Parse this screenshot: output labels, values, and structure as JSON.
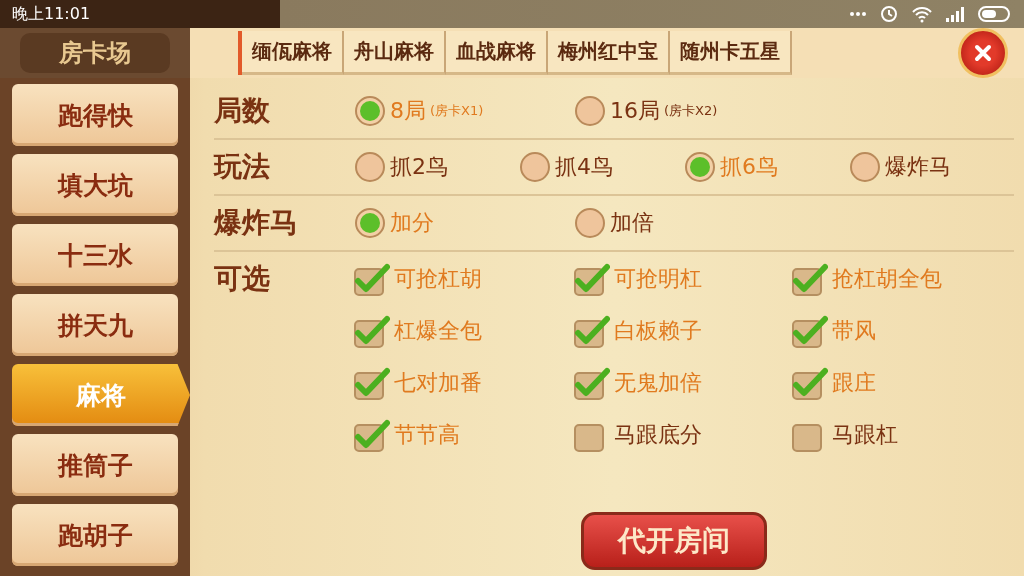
{
  "status_bar": {
    "time": "晚上11:01"
  },
  "header": {
    "title": "房卡场"
  },
  "tabs": [
    {
      "label": "缅佤麻将",
      "selected": false
    },
    {
      "label": "舟山麻将",
      "selected": false
    },
    {
      "label": "血战麻将",
      "selected": false
    },
    {
      "label": "梅州红中宝",
      "selected": false
    },
    {
      "label": "随州卡五星",
      "selected": false
    }
  ],
  "sidebar": {
    "items": [
      {
        "label": "跑得快",
        "selected": false
      },
      {
        "label": "填大坑",
        "selected": false
      },
      {
        "label": "十三水",
        "selected": false
      },
      {
        "label": "拼天九",
        "selected": false
      },
      {
        "label": "麻将",
        "selected": true
      },
      {
        "label": "推筒子",
        "selected": false
      },
      {
        "label": "跑胡子",
        "selected": false
      }
    ]
  },
  "rule_groups": [
    {
      "label": "局数",
      "kind": "radio",
      "options": [
        {
          "label": "8局",
          "note": "(房卡X1)",
          "selected": true
        },
        {
          "label": "16局",
          "note": "(房卡X2)",
          "selected": false
        }
      ]
    },
    {
      "label": "玩法",
      "kind": "radio",
      "options": [
        {
          "label": "抓2鸟",
          "selected": false
        },
        {
          "label": "抓4鸟",
          "selected": false
        },
        {
          "label": "抓6鸟",
          "selected": true
        },
        {
          "label": "爆炸马",
          "selected": false
        }
      ]
    },
    {
      "label": "爆炸马",
      "kind": "radio",
      "options": [
        {
          "label": "加分",
          "selected": true
        },
        {
          "label": "加倍",
          "selected": false
        }
      ]
    },
    {
      "label": "可选",
      "kind": "checkbox",
      "options": [
        {
          "label": "可抢杠胡",
          "checked": true
        },
        {
          "label": "可抢明杠",
          "checked": true
        },
        {
          "label": "抢杠胡全包",
          "checked": true
        },
        {
          "label": "杠爆全包",
          "checked": true
        },
        {
          "label": "白板赖子",
          "checked": true
        },
        {
          "label": "带风",
          "checked": true
        },
        {
          "label": "七对加番",
          "checked": true
        },
        {
          "label": "无鬼加倍",
          "checked": true
        },
        {
          "label": "跟庄",
          "checked": true
        },
        {
          "label": "节节高",
          "checked": true
        },
        {
          "label": "马跟底分",
          "checked": false
        },
        {
          "label": "马跟杠",
          "checked": false
        }
      ]
    }
  ],
  "action_button": {
    "label": "代开房间"
  }
}
